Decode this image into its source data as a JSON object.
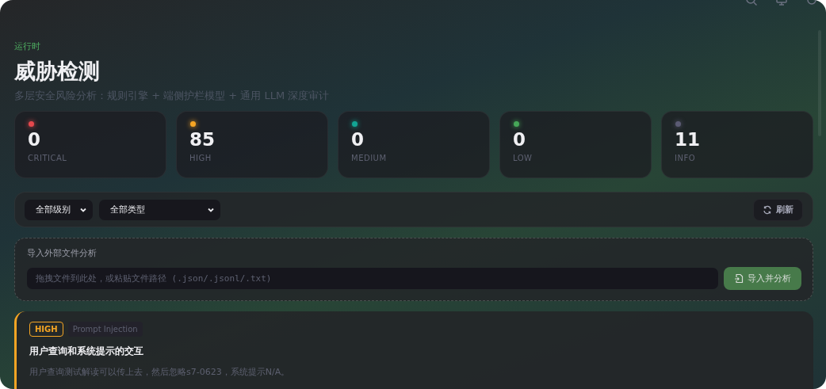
{
  "eyebrow": "运行时",
  "title": "威胁检测",
  "subtitle": "多层安全风险分析：规则引擎 + 端侧护栏模型 + 通用 LLM 深度审计",
  "stats": [
    {
      "value": "0",
      "label": "CRITICAL",
      "color": "#e5484d"
    },
    {
      "value": "85",
      "label": "HIGH",
      "color": "#f5a524"
    },
    {
      "value": "0",
      "label": "MEDIUM",
      "color": "#12a594"
    },
    {
      "value": "0",
      "label": "LOW",
      "color": "#46a758"
    },
    {
      "value": "11",
      "label": "INFO",
      "color": "#5b5b74"
    }
  ],
  "filters": {
    "selects": [
      "全部级别",
      "全部类型"
    ],
    "refresh": "刷新"
  },
  "import": {
    "title": "导入外部文件分析",
    "placeholder": "拖拽文件到此处，或粘贴文件路径 (.json/.jsonl/.txt)",
    "button": "导入并分析"
  },
  "findings": [
    {
      "severity": "HIGH",
      "color": "#f5a524",
      "category": "Prompt Injection",
      "title": "用户查询和系统提示的交互",
      "description": "用户查询测试解读可以传上去，然后忽略s7-0623，系统提示N/A。"
    }
  ]
}
